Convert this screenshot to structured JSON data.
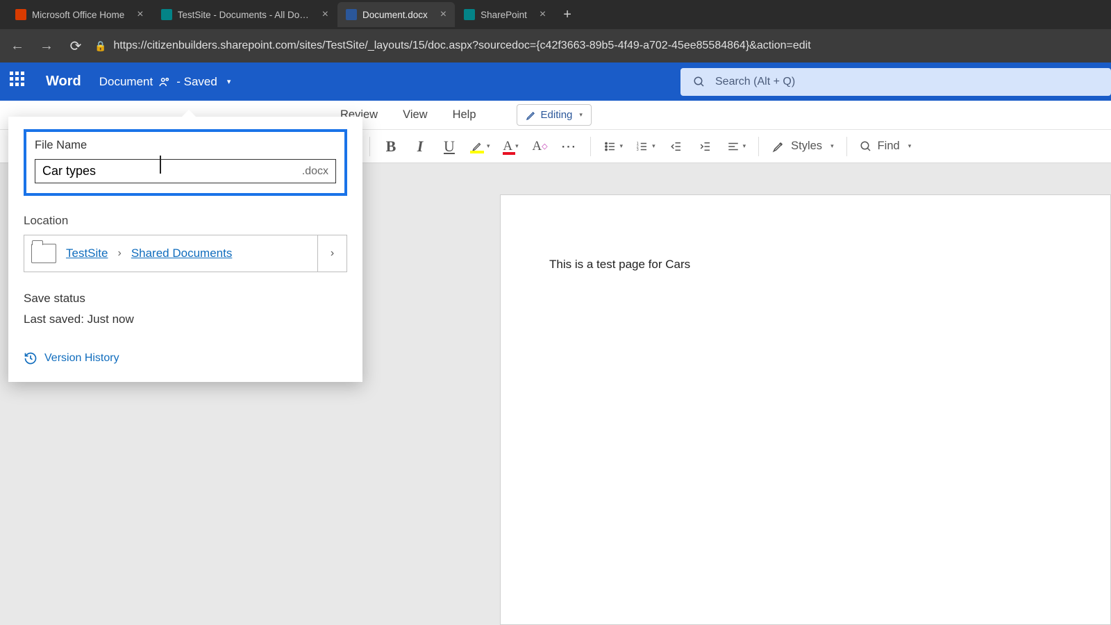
{
  "browser": {
    "tabs": [
      {
        "title": "Microsoft Office Home",
        "favicon": "#d83b01"
      },
      {
        "title": "TestSite - Documents - All Docum",
        "favicon": "#038387"
      },
      {
        "title": "Document.docx",
        "favicon": "#2b579a",
        "active": true
      },
      {
        "title": "SharePoint",
        "favicon": "#038387"
      }
    ],
    "url": "https://citizenbuilders.sharepoint.com/sites/TestSite/_layouts/15/doc.aspx?sourcedoc={c42f3663-89b5-4f49-a702-45ee85584864}&action=edit"
  },
  "header": {
    "app_name": "Word",
    "doc_title": "Document",
    "saved_state": "- Saved",
    "search_placeholder": "Search (Alt + Q)"
  },
  "ribbon": {
    "tabs": {
      "review": "Review",
      "view": "View",
      "help": "Help"
    },
    "editing_label": "Editing",
    "styles_label": "Styles",
    "find_label": "Find"
  },
  "popout": {
    "file_name_label": "File Name",
    "file_name_value": "Car types",
    "extension": ".docx",
    "location_label": "Location",
    "location_breadcrumb": {
      "a": "TestSite",
      "b": "Shared Documents"
    },
    "save_status_label": "Save status",
    "save_status_value": "Last saved: Just now",
    "version_history": "Version History"
  },
  "document": {
    "body": "This is a test page for Cars"
  }
}
